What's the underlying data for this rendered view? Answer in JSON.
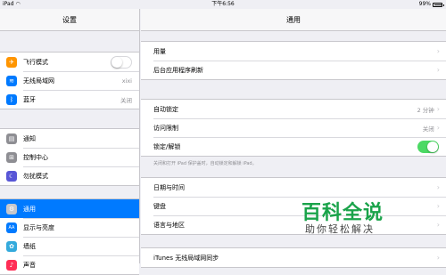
{
  "status": {
    "device": "iPad",
    "wifi_icon": "wifi-icon",
    "time": "下午6:56",
    "battery": "99%",
    "battery_level": 0.99
  },
  "master": {
    "title": "设置",
    "groups": [
      [
        {
          "label": "飞行模式",
          "icon": "airplane-icon",
          "color": "#ff9500",
          "toggle": "off"
        },
        {
          "label": "无线局域网",
          "icon": "wifi-icon",
          "color": "#007aff",
          "value": "xixi"
        },
        {
          "label": "蓝牙",
          "icon": "bluetooth-icon",
          "color": "#007aff",
          "value": "关闭"
        }
      ],
      [
        {
          "label": "通知",
          "icon": "notifications-icon",
          "color": "#8e8e93"
        },
        {
          "label": "控制中心",
          "icon": "control-center-icon",
          "color": "#8e8e93"
        },
        {
          "label": "勿扰模式",
          "icon": "moon-icon",
          "color": "#5856d6"
        }
      ],
      [
        {
          "label": "通用",
          "icon": "gear-icon",
          "color": "#8e8e93",
          "selected": true
        },
        {
          "label": "显示与亮度",
          "icon": "display-icon",
          "color": "#007aff"
        },
        {
          "label": "墙纸",
          "icon": "wallpaper-icon",
          "color": "#34aadc"
        },
        {
          "label": "声音",
          "icon": "sound-icon",
          "color": "#ff2d55"
        }
      ]
    ]
  },
  "detail": {
    "title": "通用",
    "top_partial": "",
    "group1": [
      {
        "label": "用量"
      },
      {
        "label": "后台应用程序刷新"
      }
    ],
    "group2": [
      {
        "label": "自动锁定",
        "value": "2 分钟"
      },
      {
        "label": "访问限制",
        "value": "关闭"
      },
      {
        "label": "锁定/解锁",
        "toggle": "on"
      }
    ],
    "footnote": "关闭和打开 iPad 保护盖时，自动锁定和解锁 iPad。",
    "group3": [
      {
        "label": "日期与时间"
      },
      {
        "label": "键盘"
      },
      {
        "label": "语言与地区"
      }
    ],
    "group4": [
      {
        "label": "iTunes 无线局域网同步"
      }
    ]
  },
  "watermark": {
    "title": "百科全说",
    "subtitle": "助你轻松解决",
    "color": "#1aa34a"
  }
}
